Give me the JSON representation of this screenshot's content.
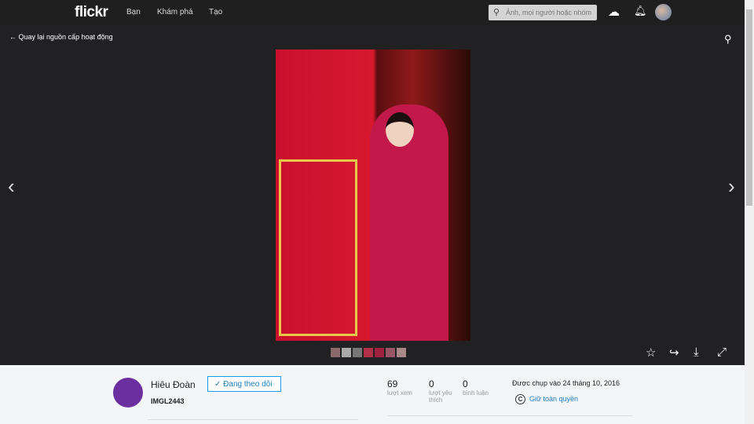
{
  "header": {
    "logo": "flickr",
    "nav": [
      "Bạn",
      "Khám phá",
      "Tạo"
    ],
    "search_placeholder": "Ảnh, mọi người hoặc nhóm"
  },
  "viewer": {
    "back_label": "Quay lại nguồn cấp hoạt động"
  },
  "photo_info": {
    "author": "Hiêu Đoàn",
    "follow_label": "✓ Đang theo dõi",
    "title": "IMGL2443",
    "stats": [
      {
        "value": "69",
        "label": "lượt xem"
      },
      {
        "value": "0",
        "label": "lượt yêu thích"
      },
      {
        "value": "0",
        "label": "bình luận"
      }
    ],
    "taken": "Được chụp vào 24 tháng 10, 2016",
    "license": "Giữ toàn quyền",
    "license_icon": "C"
  }
}
